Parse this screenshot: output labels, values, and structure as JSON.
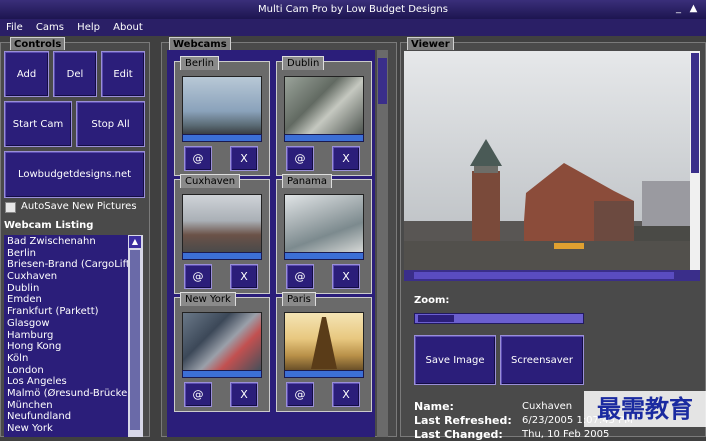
{
  "window": {
    "title": "Multi Cam Pro by Low Budget Designs",
    "min": "_",
    "max": "▲",
    "close": "✕"
  },
  "menu": [
    "File",
    "Cams",
    "Help",
    "About"
  ],
  "controls": {
    "title": "Controls",
    "add": "Add",
    "del": "Del",
    "edit": "Edit",
    "start": "Start Cam",
    "stop": "Stop All",
    "site": "Lowbudgetdesigns.net",
    "autosave": "AutoSave New Pictures"
  },
  "listing": {
    "title": "Webcam Listing",
    "items": [
      "Bad Zwischenahn",
      "Berlin",
      "Briesen-Brand (CargoLifter",
      "Cuxhaven",
      "Dublin",
      "Emden",
      "Frankfurt (Parkett)",
      "Glasgow",
      "Hamburg",
      "Hong Kong",
      "Köln",
      "London",
      "Los Angeles",
      "Malmö (Øresund-Brücke)",
      "München",
      "Neufundland",
      "New York"
    ]
  },
  "webcams": {
    "title": "Webcams",
    "cams": [
      {
        "name": "Berlin"
      },
      {
        "name": "Dublin"
      },
      {
        "name": "Cuxhaven"
      },
      {
        "name": "Panama"
      },
      {
        "name": "New York"
      },
      {
        "name": "Paris"
      }
    ],
    "btn_refresh": "@",
    "btn_close": "X"
  },
  "viewer": {
    "title": "Viewer",
    "zoom_label": "Zoom:"
  },
  "actions": {
    "save": "Save Image",
    "screensaver": "Screensaver"
  },
  "info": {
    "name_label": "Name:",
    "name_value": "Cuxhaven",
    "refreshed_label": "Last Refreshed:",
    "refreshed_value": "6/23/2005 1:07:45 PM",
    "changed_label": "Last Changed:",
    "changed_value": "Thu, 10 Feb 2005"
  },
  "watermark": "最需教育",
  "colors": {
    "button": "#2b1e7a",
    "titlebar": "#2a1f66",
    "panel": "#4a4a4a",
    "list_bg": "#2b1e7a"
  }
}
